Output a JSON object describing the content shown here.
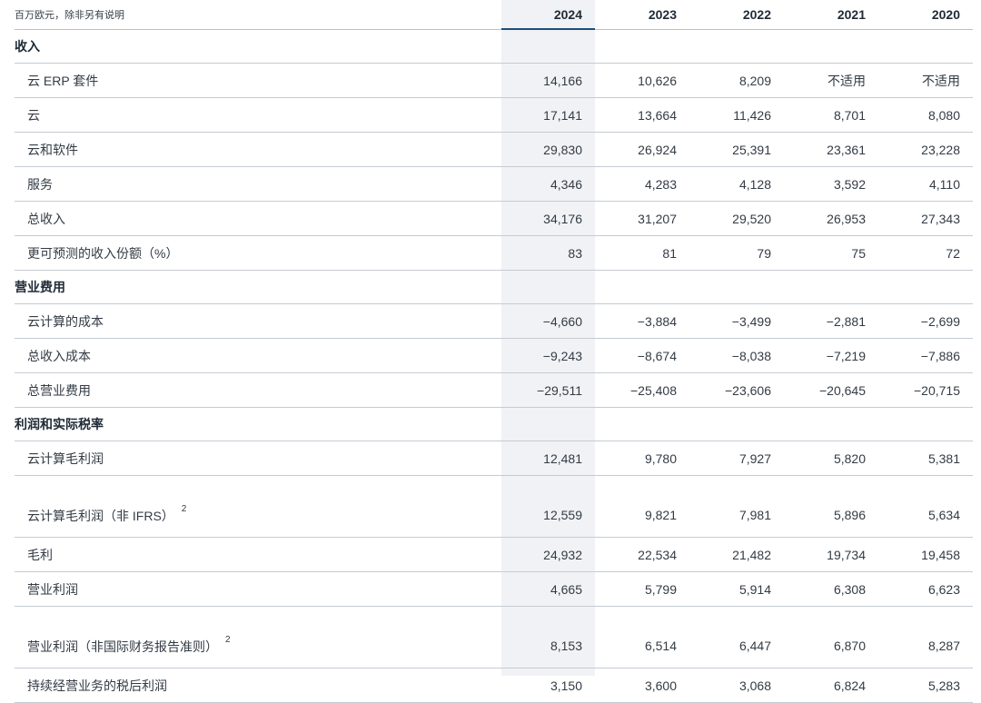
{
  "header": {
    "caption": "百万欧元，除非另有说明",
    "years": [
      "2024",
      "2023",
      "2022",
      "2021",
      "2020"
    ]
  },
  "sections": [
    {
      "title": "收入",
      "rows": [
        {
          "label": "云 ERP 套件",
          "values": [
            "14,166",
            "10,626",
            "8,209",
            "不适用",
            "不适用"
          ]
        },
        {
          "label": "云",
          "values": [
            "17,141",
            "13,664",
            "11,426",
            "8,701",
            "8,080"
          ]
        },
        {
          "label": "云和软件",
          "values": [
            "29,830",
            "26,924",
            "25,391",
            "23,361",
            "23,228"
          ]
        },
        {
          "label": "服务",
          "values": [
            "4,346",
            "4,283",
            "4,128",
            "3,592",
            "4,110"
          ]
        },
        {
          "label": "总收入",
          "values": [
            "34,176",
            "31,207",
            "29,520",
            "26,953",
            "27,343"
          ]
        },
        {
          "label": "更可预测的收入份额（%）",
          "values": [
            "83",
            "81",
            "79",
            "75",
            "72"
          ]
        }
      ]
    },
    {
      "title": "营业费用",
      "rows": [
        {
          "label": "云计算的成本",
          "values": [
            "−4,660",
            "−3,884",
            "−3,499",
            "−2,881",
            "−2,699"
          ]
        },
        {
          "label": "总收入成本",
          "values": [
            "−9,243",
            "−8,674",
            "−8,038",
            "−7,219",
            "−7,886"
          ]
        },
        {
          "label": "总营业费用",
          "values": [
            "−29,511",
            "−25,408",
            "−23,606",
            "−20,645",
            "−20,715"
          ]
        }
      ]
    },
    {
      "title": "利润和实际税率",
      "rows": [
        {
          "label": "云计算毛利润",
          "values": [
            "12,481",
            "9,780",
            "7,927",
            "5,820",
            "5,381"
          ]
        },
        {
          "label": "云计算毛利润（非 IFRS）",
          "footnote": "2",
          "values": [
            "12,559",
            "9,821",
            "7,981",
            "5,896",
            "5,634"
          ]
        },
        {
          "label": "毛利",
          "values": [
            "24,932",
            "22,534",
            "21,482",
            "19,734",
            "19,458"
          ]
        },
        {
          "label": "营业利润",
          "values": [
            "4,665",
            "5,799",
            "5,914",
            "6,308",
            "6,623"
          ]
        },
        {
          "label": "营业利润（非国际财务报告准则）",
          "footnote": "2",
          "values": [
            "8,153",
            "6,514",
            "6,447",
            "6,870",
            "8,287"
          ]
        },
        {
          "label": "持续经营业务的税后利润",
          "values": [
            "3,150",
            "3,600",
            "3,068",
            "6,824",
            "5,283"
          ]
        }
      ]
    }
  ]
}
